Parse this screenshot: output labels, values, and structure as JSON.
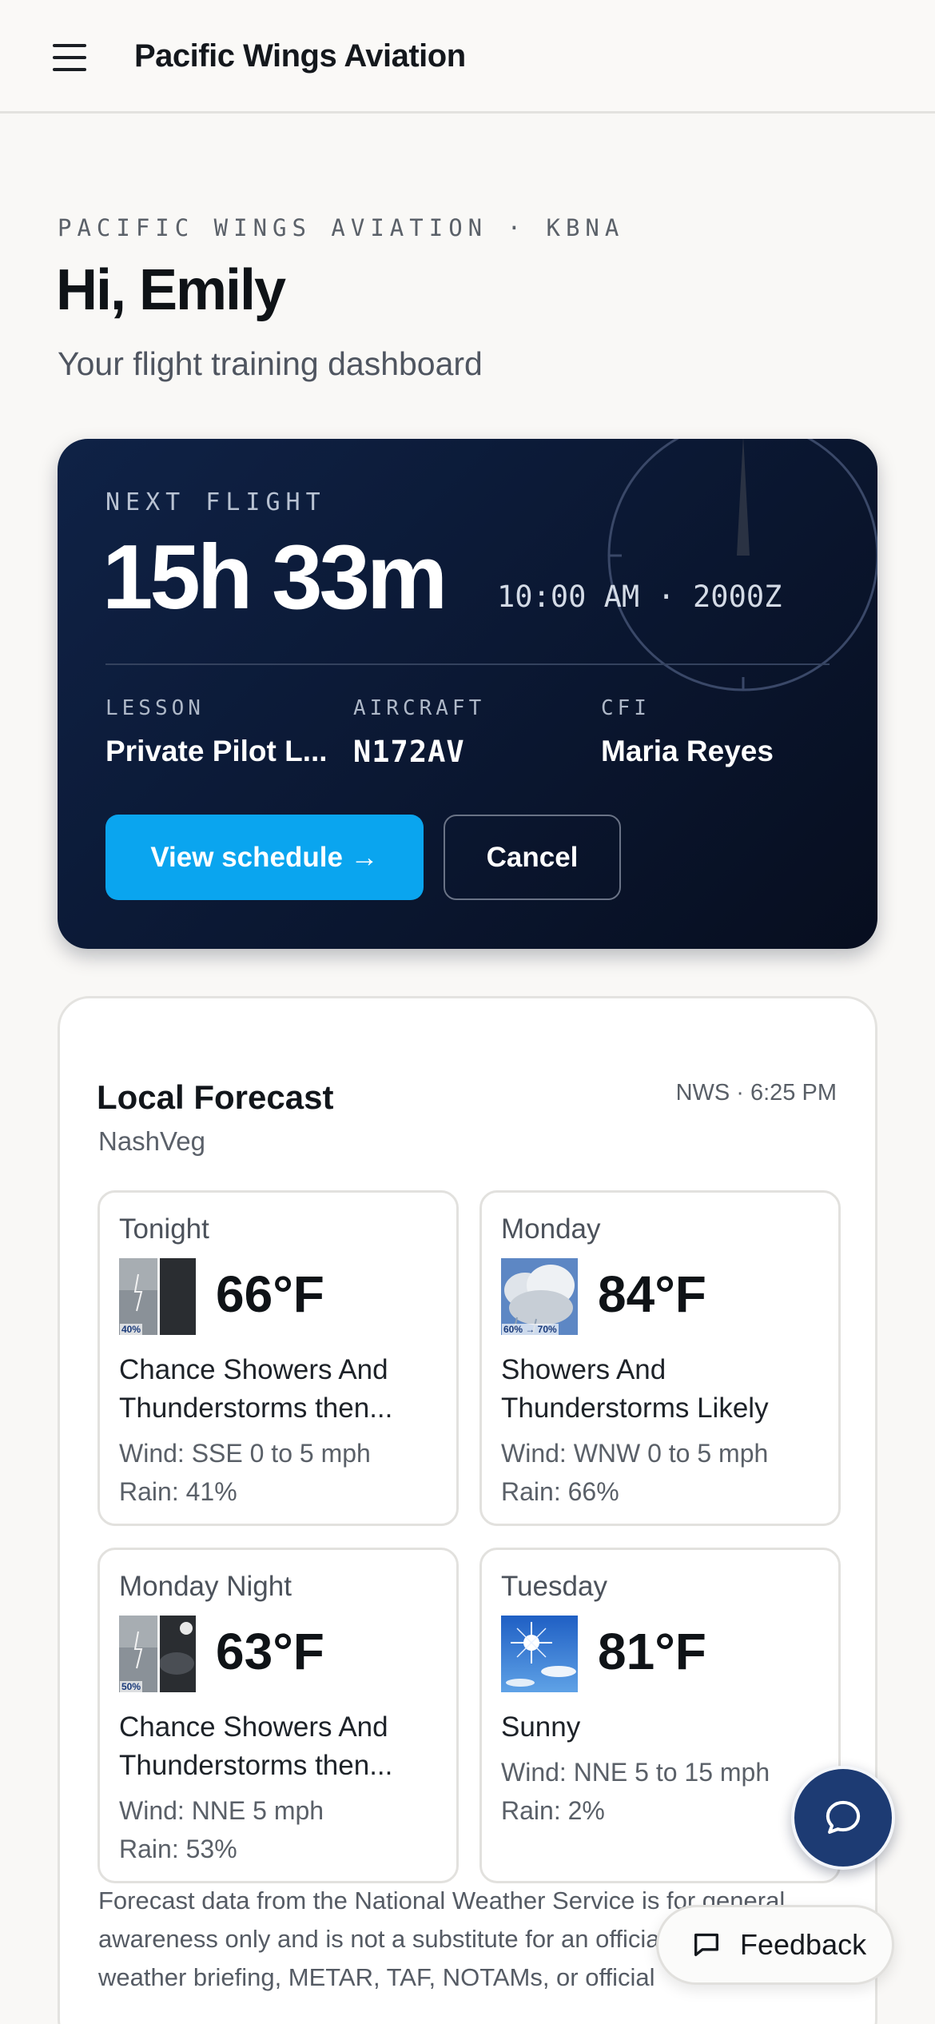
{
  "app": {
    "title": "Pacific Wings Aviation"
  },
  "header": {
    "eyebrow": "PACIFIC WINGS AVIATION · KBNA",
    "greeting": "Hi, Emily",
    "subtitle": "Your flight training dashboard"
  },
  "next_flight": {
    "label": "NEXT FLIGHT",
    "countdown": "15h 33m",
    "time": "10:00 AM · 2000Z",
    "lesson_label": "LESSON",
    "lesson_value": "Private Pilot L...",
    "aircraft_label": "AIRCRAFT",
    "aircraft_value": "N172AV",
    "cfi_label": "CFI",
    "cfi_value": "Maria Reyes",
    "primary_button": "View schedule →",
    "secondary_button": "Cancel"
  },
  "forecast": {
    "title": "Local Forecast",
    "location": "NashVeg",
    "source": "NWS · 6:25 PM",
    "days": [
      {
        "name": "Tonight",
        "temp": "66°F",
        "desc_1": "Chance Showers And",
        "desc_2": "Thunderstorms then...",
        "wind": "Wind: SSE 0 to 5 mph",
        "rain": "Rain: 41%",
        "icon": "thunderstorm-night-icon",
        "icon_pct": "40%"
      },
      {
        "name": "Monday",
        "temp": "84°F",
        "desc_1": "Showers And",
        "desc_2": "Thunderstorms Likely",
        "wind": "Wind: WNW 0 to 5 mph",
        "rain": "Rain: 66%",
        "icon": "cloudy-showers-icon",
        "icon_pct": "60% → 70%"
      },
      {
        "name": "Monday Night",
        "temp": "63°F",
        "desc_1": "Chance Showers And",
        "desc_2": "Thunderstorms then...",
        "wind": "Wind: NNE 5 mph",
        "rain": "Rain: 53%",
        "icon": "thunderstorm-moon-icon",
        "icon_pct": "50%"
      },
      {
        "name": "Tuesday",
        "temp": "81°F",
        "desc_1": "Sunny",
        "desc_2": "",
        "wind": "Wind: NNE 5 to 15 mph",
        "rain": "Rain: 2%",
        "icon": "sunny-icon",
        "icon_pct": ""
      }
    ],
    "disclaimer": "Forecast data from the National Weather Service is for general awareness only and is not a substitute for an official aviation weather briefing, METAR, TAF, NOTAMs, or official"
  },
  "fab": {
    "icon": "chat-bubble-icon"
  },
  "feedback": {
    "label": "Feedback",
    "icon": "message-square-icon"
  },
  "colors": {
    "accent": "#0aa5ef",
    "card_dark": "#0b1833",
    "fab": "#1d3b73"
  }
}
